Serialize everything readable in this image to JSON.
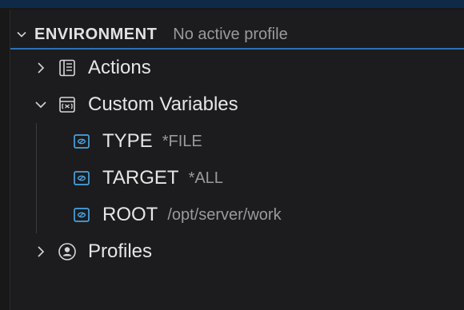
{
  "section": {
    "title": "ENVIRONMENT",
    "description": "No active profile",
    "expanded": true
  },
  "tree": {
    "actions": {
      "label": "Actions",
      "icon": "book-icon",
      "expanded": false
    },
    "custom_variables": {
      "label": "Custom Variables",
      "icon": "variable-group-icon",
      "expanded": true,
      "items": [
        {
          "name": "TYPE",
          "value": "*FILE",
          "icon": "variable-icon"
        },
        {
          "name": "TARGET",
          "value": "*ALL",
          "icon": "variable-icon"
        },
        {
          "name": "ROOT",
          "value": "/opt/server/work",
          "icon": "variable-icon"
        }
      ]
    },
    "profiles": {
      "label": "Profiles",
      "icon": "account-icon",
      "expanded": false
    }
  },
  "colors": {
    "background": "#1c1c1e",
    "accent": "#2f6fb4",
    "variable_icon": "#4aa3e0",
    "text": "#e6e6e6",
    "muted_text": "#9a9a9a"
  }
}
